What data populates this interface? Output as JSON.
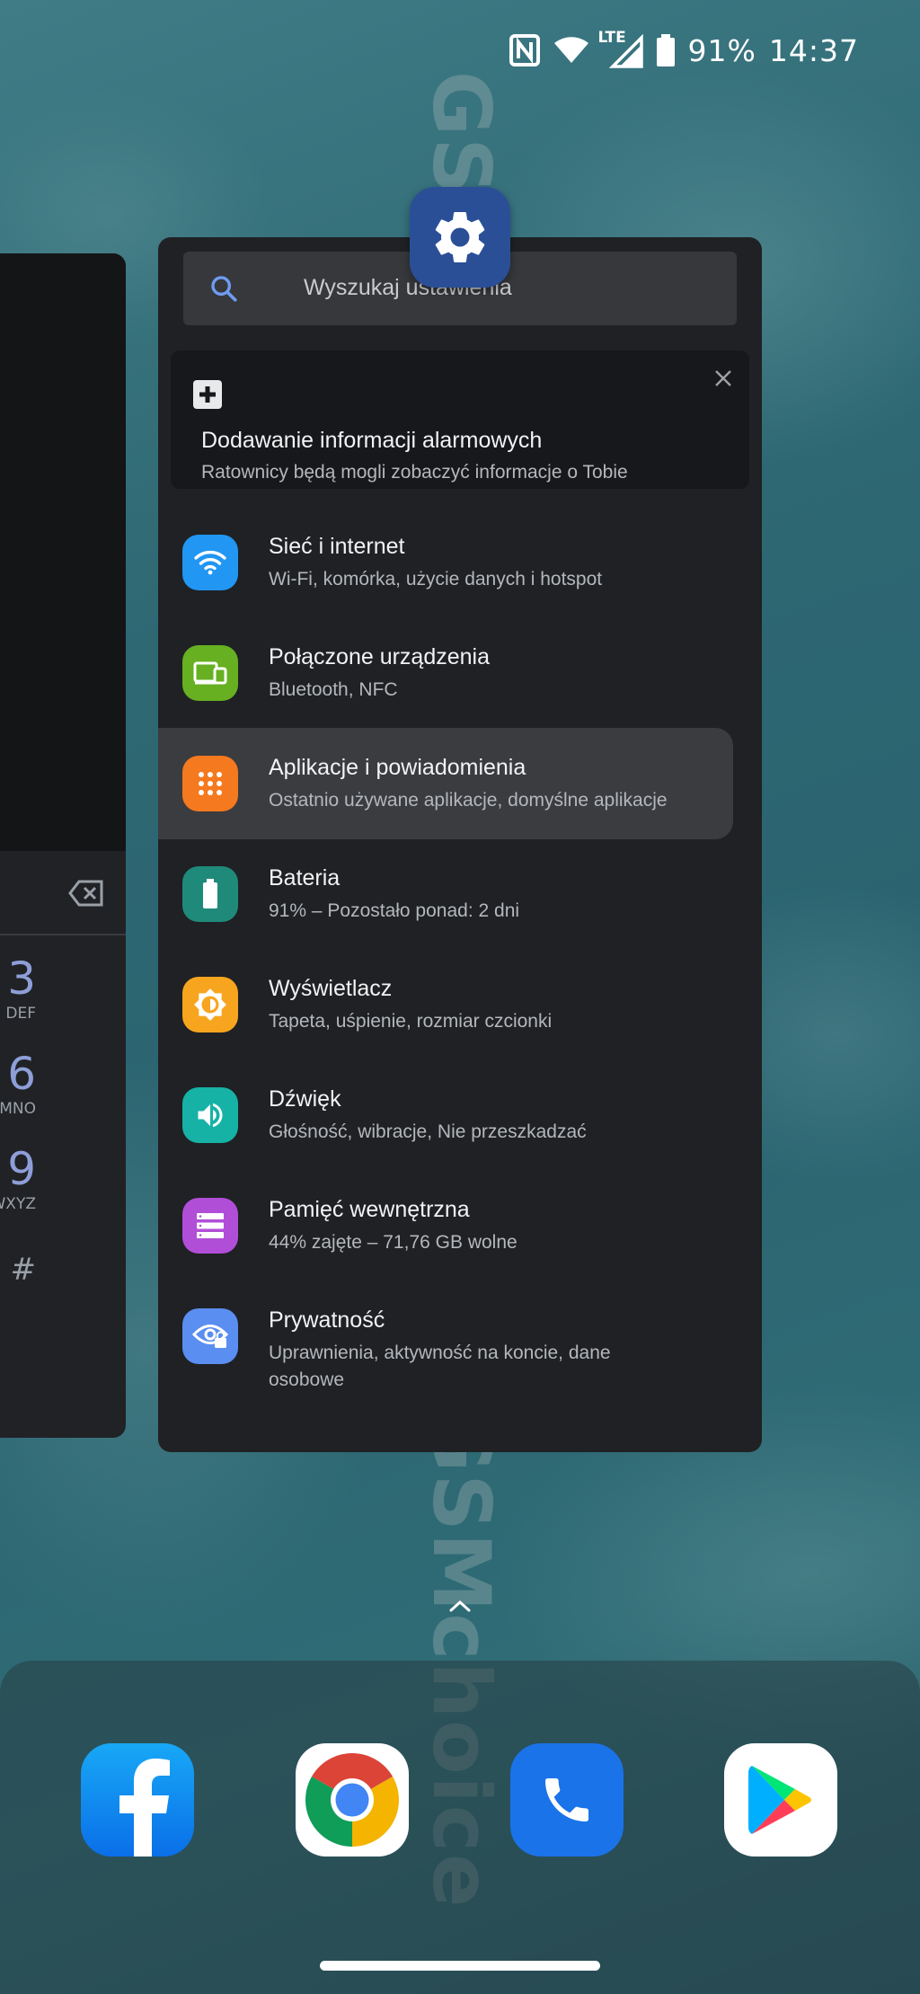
{
  "status_bar": {
    "battery": "91%",
    "time": "14:37",
    "network": "LTE",
    "icons": [
      "nfc-icon",
      "wifi-icon",
      "signal-icon",
      "battery-icon"
    ]
  },
  "dialer_peek": {
    "keys": [
      {
        "num": "3",
        "letters": "DEF"
      },
      {
        "num": "6",
        "letters": "MNO"
      },
      {
        "num": "9",
        "letters": "WXYZ"
      },
      {
        "num": "#",
        "letters": ""
      }
    ]
  },
  "settings": {
    "search_placeholder": "Wyszukaj ustawienia",
    "suggestion": {
      "title": "Dodawanie informacji alarmowych",
      "subtitle": "Ratownicy będą mogli zobaczyć informacje o Tobie"
    },
    "items": [
      {
        "title": "Sieć i internet",
        "subtitle": "Wi-Fi, komórka, użycie danych i hotspot",
        "icon": "wifi-icon",
        "color": "#2196f3"
      },
      {
        "title": "Połączone urządzenia",
        "subtitle": "Bluetooth, NFC",
        "icon": "devices-icon",
        "color": "#66b021"
      },
      {
        "title": "Aplikacje i powiadomienia",
        "subtitle": "Ostatnio używane aplikacje, domyślne aplikacje",
        "icon": "apps-icon",
        "color": "#f5791f"
      },
      {
        "title": "Bateria",
        "subtitle": "91% – Pozostało ponad: 2 dni",
        "icon": "battery-icon",
        "color": "#1f8a7a"
      },
      {
        "title": "Wyświetlacz",
        "subtitle": "Tapeta, uśpienie, rozmiar czcionki",
        "icon": "brightness-icon",
        "color": "#f7a51f"
      },
      {
        "title": "Dźwięk",
        "subtitle": "Głośność, wibracje, Nie przeszkadzać",
        "icon": "volume-icon",
        "color": "#16b2a6"
      },
      {
        "title": "Pamięć wewnętrzna",
        "subtitle": "44% zajęte – 71,76 GB wolne",
        "icon": "storage-icon",
        "color": "#b14ed8"
      },
      {
        "title": "Prywatność",
        "subtitle": "Uprawnienia, aktywność na koncie, dane osobowe",
        "icon": "privacy-icon",
        "color": "#5a8ef0"
      }
    ]
  },
  "dock": {
    "apps": [
      "facebook-icon",
      "chrome-icon",
      "phone-icon",
      "play-store-icon"
    ]
  },
  "watermark": "GSMchoice"
}
